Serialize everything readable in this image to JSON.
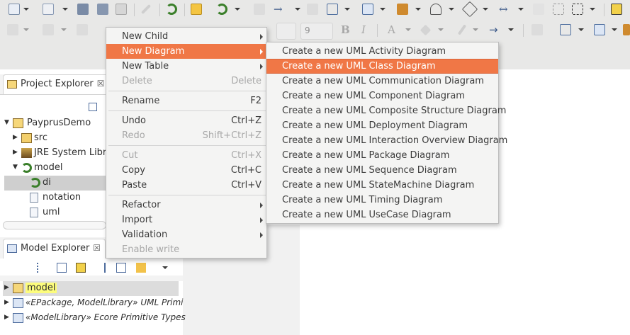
{
  "context_menu": {
    "items": [
      {
        "label": "New Child",
        "shortcut": "",
        "submenu": true,
        "disabled": false
      },
      {
        "label": "New Diagram",
        "shortcut": "",
        "submenu": true,
        "disabled": false,
        "highlighted": true
      },
      {
        "label": "New Table",
        "shortcut": "",
        "submenu": true,
        "disabled": false
      },
      {
        "label": "Delete",
        "shortcut": "Delete",
        "submenu": false,
        "disabled": true
      },
      {
        "label": "Rename",
        "shortcut": "F2",
        "submenu": false,
        "disabled": false
      },
      {
        "label": "Undo",
        "shortcut": "Ctrl+Z",
        "submenu": false,
        "disabled": false
      },
      {
        "label": "Redo",
        "shortcut": "Shift+Ctrl+Z",
        "submenu": false,
        "disabled": true
      },
      {
        "label": "Cut",
        "shortcut": "Ctrl+X",
        "submenu": false,
        "disabled": true
      },
      {
        "label": "Copy",
        "shortcut": "Ctrl+C",
        "submenu": false,
        "disabled": false
      },
      {
        "label": "Paste",
        "shortcut": "Ctrl+V",
        "submenu": false,
        "disabled": false
      },
      {
        "label": "Refactor",
        "shortcut": "",
        "submenu": true,
        "disabled": false
      },
      {
        "label": "Import",
        "shortcut": "",
        "submenu": true,
        "disabled": false
      },
      {
        "label": "Validation",
        "shortcut": "",
        "submenu": true,
        "disabled": false
      },
      {
        "label": "Enable write",
        "shortcut": "",
        "submenu": false,
        "disabled": true
      }
    ]
  },
  "diagram_submenu": {
    "items": [
      "Create a new UML Activity Diagram",
      "Create a new UML Class Diagram",
      "Create a new UML Communication Diagram",
      "Create a new UML Component Diagram",
      "Create a new UML Composite Structure Diagram",
      "Create a new UML Deployment Diagram",
      "Create a new UML Interaction Overview Diagram",
      "Create a new UML Package Diagram",
      "Create a new UML Sequence Diagram",
      "Create a new UML StateMachine Diagram",
      "Create a new UML Timing Diagram",
      "Create a new UML UseCase Diagram"
    ],
    "highlighted_index": 1
  },
  "project_explorer": {
    "title": "Project Explorer",
    "close": "☒",
    "tree": [
      {
        "label": "PayprusDemo",
        "icon": "project-icon",
        "expanded": true
      },
      {
        "label": "src",
        "icon": "source-folder-icon",
        "expanded": false
      },
      {
        "label": "JRE System Libra",
        "icon": "library-icon",
        "expanded": false
      },
      {
        "label": "model",
        "icon": "papyrus-model-icon",
        "expanded": true
      },
      {
        "label": "di",
        "icon": "papyrus-model-icon",
        "selected": true
      },
      {
        "label": "notation",
        "icon": "file-icon"
      },
      {
        "label": "uml",
        "icon": "file-icon"
      }
    ]
  },
  "model_explorer": {
    "title": "Model Explorer",
    "close": "☒",
    "tree": [
      {
        "label": "model",
        "icon": "model-package-icon",
        "selected": true
      },
      {
        "label": "«EPackage, ModelLibrary» UML Primi",
        "icon": "model-library-icon"
      },
      {
        "label": "«ModelLibrary» Ecore Primitive Types",
        "icon": "model-library-icon"
      }
    ]
  },
  "toolbar": {
    "font_size_value": "9",
    "bold_label": "B",
    "italic_label": "I",
    "font_color_label": "A"
  },
  "colors": {
    "menu_highlight": "#f07746",
    "toolbar_bg": "#e8e8e7",
    "menu_bg": "#f4f4f3",
    "selected_model_bg": "#fdfd7c"
  }
}
